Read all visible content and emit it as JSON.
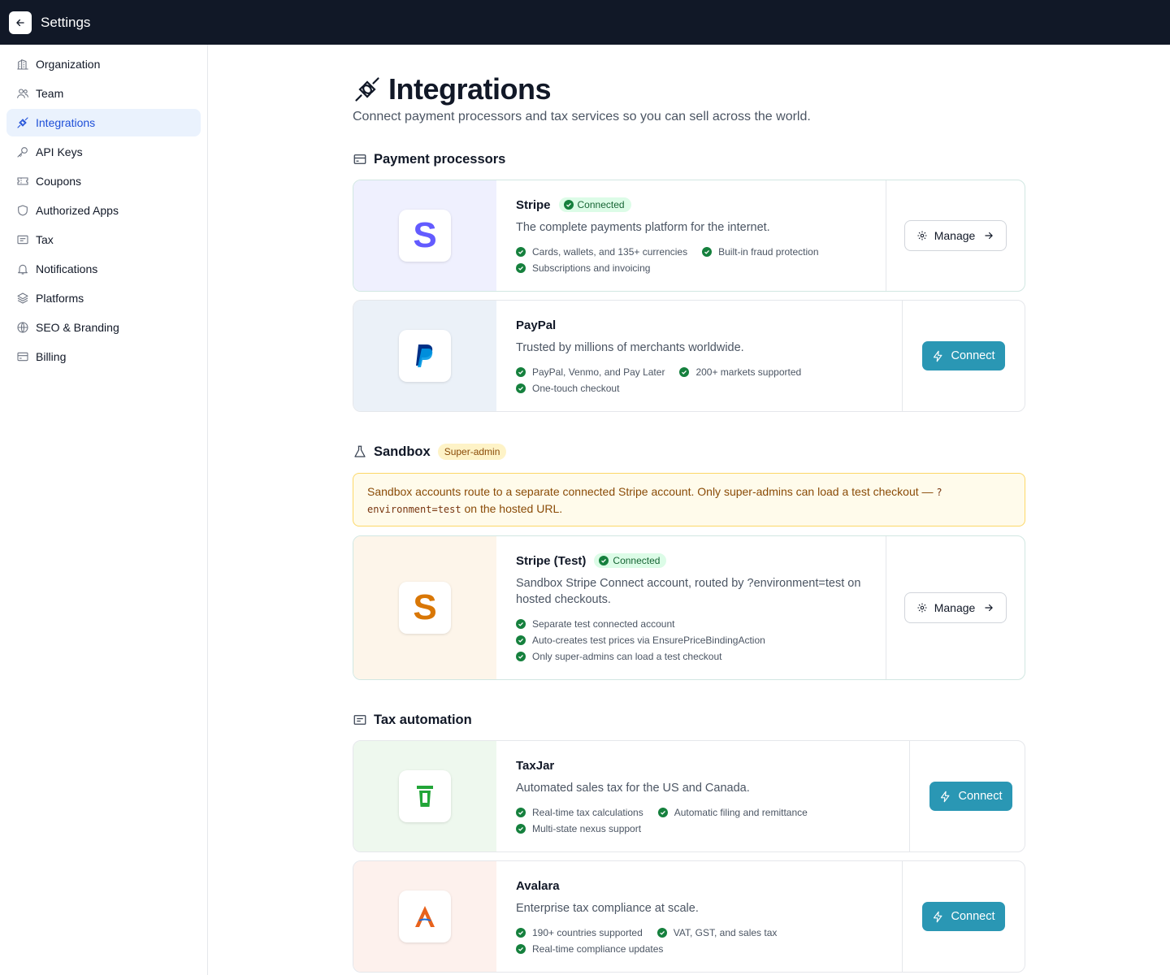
{
  "topbar": {
    "title": "Settings"
  },
  "sidebar": {
    "items": [
      {
        "label": "Organization",
        "icon": "building-icon"
      },
      {
        "label": "Team",
        "icon": "users-icon"
      },
      {
        "label": "Integrations",
        "icon": "plug-icon",
        "active": true
      },
      {
        "label": "API Keys",
        "icon": "key-icon"
      },
      {
        "label": "Coupons",
        "icon": "ticket-icon"
      },
      {
        "label": "Authorized Apps",
        "icon": "shield-icon"
      },
      {
        "label": "Tax",
        "icon": "receipt-icon"
      },
      {
        "label": "Notifications",
        "icon": "bell-icon"
      },
      {
        "label": "Platforms",
        "icon": "layers-icon"
      },
      {
        "label": "SEO & Branding",
        "icon": "globe-icon"
      },
      {
        "label": "Billing",
        "icon": "credit-card-icon"
      }
    ]
  },
  "page": {
    "title": "Integrations",
    "subtitle": "Connect payment processors and tax services so you can sell across the world."
  },
  "sections": {
    "payments": {
      "title": "Payment processors"
    },
    "sandbox": {
      "title": "Sandbox",
      "badge": "Super-admin"
    },
    "tax": {
      "title": "Tax automation"
    }
  },
  "notice": {
    "text_before": "Sandbox accounts route to a separate connected Stripe account. Only super-admins can load a test checkout — ",
    "code": "?environment=test",
    "text_after": " on the hosted URL."
  },
  "cards": {
    "stripe": {
      "name": "Stripe",
      "status": "Connected",
      "description": "The complete payments platform for the internet.",
      "features": [
        "Cards, wallets, and 135+ currencies",
        "Built-in fraud protection",
        "Subscriptions and invoicing"
      ],
      "action": "Manage"
    },
    "paypal": {
      "name": "PayPal",
      "description": "Trusted by millions of merchants worldwide.",
      "features": [
        "PayPal, Venmo, and Pay Later",
        "200+ markets supported",
        "One-touch checkout"
      ],
      "action": "Connect"
    },
    "stripe_test": {
      "name": "Stripe (Test)",
      "status": "Connected",
      "description": "Sandbox Stripe Connect account, routed by ?environment=test on hosted checkouts.",
      "features": [
        "Separate test connected account",
        "Auto-creates test prices via EnsurePriceBindingAction",
        "Only super-admins can load a test checkout"
      ],
      "action": "Manage"
    },
    "taxjar": {
      "name": "TaxJar",
      "description": "Automated sales tax for the US and Canada.",
      "features": [
        "Real-time tax calculations",
        "Automatic filing and remittance",
        "Multi-state nexus support"
      ],
      "action": "Connect"
    },
    "avalara": {
      "name": "Avalara",
      "description": "Enterprise tax compliance at scale.",
      "features": [
        "190+ countries supported",
        "VAT, GST, and sales tax",
        "Real-time compliance updates"
      ],
      "action": "Connect"
    }
  },
  "colors": {
    "topbar": "#111827",
    "accent": "#1e4fd8",
    "connect_button": "#2a97b4",
    "success": "#15803d",
    "stripe_purple": "#635bff",
    "stripe_test_orange": "#d97706",
    "taxjar_green": "#22a538",
    "avalara_orange": "#e8621c"
  }
}
